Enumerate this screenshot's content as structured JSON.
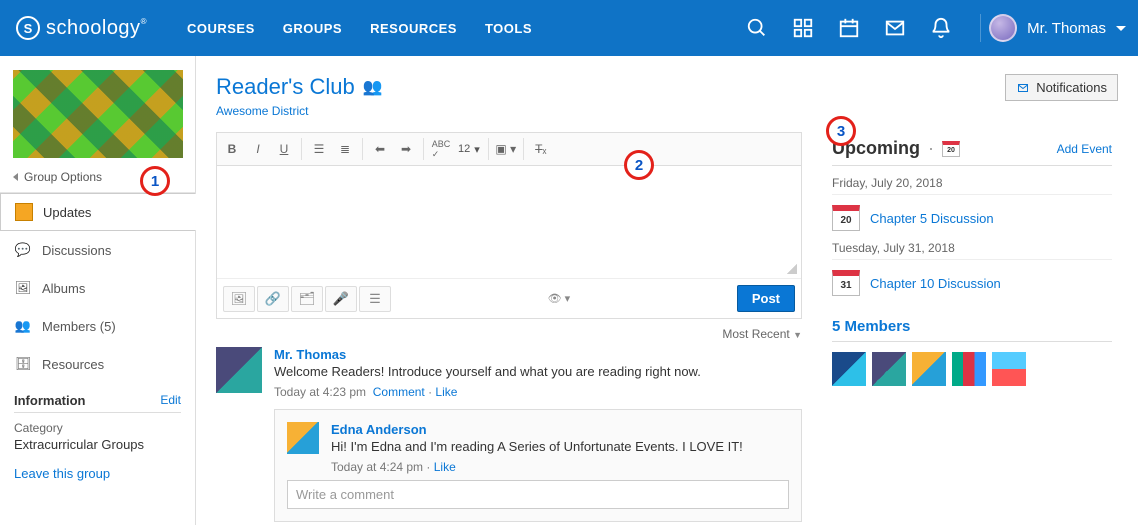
{
  "header": {
    "brand": "schoology",
    "nav": [
      "COURSES",
      "GROUPS",
      "RESOURCES",
      "TOOLS"
    ],
    "user": "Mr. Thomas"
  },
  "sidebar": {
    "group_options": "Group Options",
    "items": [
      {
        "label": "Updates",
        "active": true
      },
      {
        "label": "Discussions",
        "active": false
      },
      {
        "label": "Albums",
        "active": false
      },
      {
        "label": "Members (5)",
        "active": false
      },
      {
        "label": "Resources",
        "active": false
      }
    ],
    "info_heading": "Information",
    "info_edit": "Edit",
    "info_category_label": "Category",
    "info_category_value": "Extracurricular Groups",
    "leave": "Leave this group"
  },
  "group": {
    "title": "Reader's Club",
    "district": "Awesome District"
  },
  "composer": {
    "font_size": "12",
    "post_label": "Post"
  },
  "sort": {
    "label": "Most Recent"
  },
  "update": {
    "author": "Mr. Thomas",
    "text": "Welcome Readers! Introduce yourself and what you are reading right now.",
    "time": "Today at 4:23 pm",
    "comment_label": "Comment",
    "like_label": "Like"
  },
  "reply": {
    "author": "Edna Anderson",
    "text": "Hi! I'm Edna and I'm reading A Series of Unfortunate Events. I LOVE IT!",
    "time": "Today at 4:24 pm",
    "like_label": "Like",
    "placeholder": "Write a comment"
  },
  "notifications_btn": "Notifications",
  "upcoming": {
    "heading": "Upcoming",
    "add_event": "Add Event",
    "groups": [
      {
        "date": "Friday, July 20, 2018",
        "day": "20",
        "event": "Chapter 5 Discussion"
      },
      {
        "date": "Tuesday, July 31, 2018",
        "day": "31",
        "event": "Chapter 10 Discussion"
      }
    ]
  },
  "members": {
    "heading": "5 Members"
  },
  "annotations": {
    "a1": "1",
    "a2": "2",
    "a3": "3"
  }
}
